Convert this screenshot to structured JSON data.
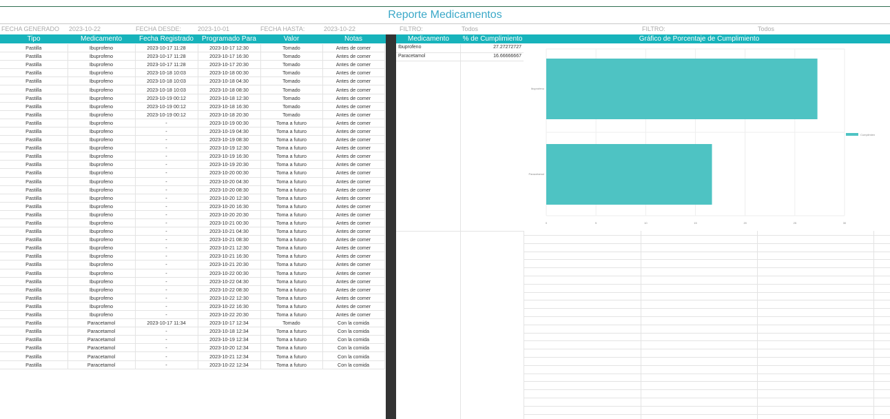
{
  "report": {
    "title": "Reporte Medicamentos",
    "meta": {
      "generado_label": "FECHA GENERADO",
      "generado_value": "2023-10-22",
      "desde_label": "FECHA DESDE:",
      "desde_value": "2023-10-01",
      "hasta_label": "FECHA HASTA:",
      "hasta_value": "2023-10-22",
      "filtro1_label": "FILTRO:",
      "filtro1_value": "Todos",
      "filtro2_label": "FILTRO:",
      "filtro2_value": "Todos"
    },
    "headers": {
      "tipo": "Tipo",
      "medicamento": "Medicamento",
      "fecha_registrado": "Fecha Registrado",
      "programado_para": "Programado Para",
      "valor": "Valor",
      "notas": "Notas",
      "sum_medicamento": "Medicamento",
      "sum_cumplimiento": "% de Cumplimiento",
      "grafico": "Gráfico de Porcentaje de Cumplimiento"
    },
    "rows": [
      [
        "Pastilla",
        "Ibuprofeno",
        "2023-10-17 11:28",
        "2023-10-17 12:30",
        "Tomado",
        "Antes de comer"
      ],
      [
        "Pastilla",
        "Ibuprofeno",
        "2023-10-17 11:28",
        "2023-10-17 16:30",
        "Tomado",
        "Antes de comer"
      ],
      [
        "Pastilla",
        "Ibuprofeno",
        "2023-10-17 11:28",
        "2023-10-17 20:30",
        "Tomado",
        "Antes de comer"
      ],
      [
        "Pastilla",
        "Ibuprofeno",
        "2023-10-18 10:03",
        "2023-10-18 00:30",
        "Tomado",
        "Antes de comer"
      ],
      [
        "Pastilla",
        "Ibuprofeno",
        "2023-10-18 10:03",
        "2023-10-18 04:30",
        "Tomado",
        "Antes de comer"
      ],
      [
        "Pastilla",
        "Ibuprofeno",
        "2023-10-18 10:03",
        "2023-10-18 08:30",
        "Tomado",
        "Antes de comer"
      ],
      [
        "Pastilla",
        "Ibuprofeno",
        "2023-10-19 00:12",
        "2023-10-18 12:30",
        "Tomado",
        "Antes de comer"
      ],
      [
        "Pastilla",
        "Ibuprofeno",
        "2023-10-19 00:12",
        "2023-10-18 16:30",
        "Tomado",
        "Antes de comer"
      ],
      [
        "Pastilla",
        "Ibuprofeno",
        "2023-10-19 00:12",
        "2023-10-18 20:30",
        "Tomado",
        "Antes de comer"
      ],
      [
        "Pastilla",
        "Ibuprofeno",
        "-",
        "2023-10-19 00:30",
        "Toma a futuro",
        "Antes de comer"
      ],
      [
        "Pastilla",
        "Ibuprofeno",
        "-",
        "2023-10-19 04:30",
        "Toma a futuro",
        "Antes de comer"
      ],
      [
        "Pastilla",
        "Ibuprofeno",
        "-",
        "2023-10-19 08:30",
        "Toma a futuro",
        "Antes de comer"
      ],
      [
        "Pastilla",
        "Ibuprofeno",
        "-",
        "2023-10-19 12:30",
        "Toma a futuro",
        "Antes de comer"
      ],
      [
        "Pastilla",
        "Ibuprofeno",
        "-",
        "2023-10-19 16:30",
        "Toma a futuro",
        "Antes de comer"
      ],
      [
        "Pastilla",
        "Ibuprofeno",
        "-",
        "2023-10-19 20:30",
        "Toma a futuro",
        "Antes de comer"
      ],
      [
        "Pastilla",
        "Ibuprofeno",
        "-",
        "2023-10-20 00:30",
        "Toma a futuro",
        "Antes de comer"
      ],
      [
        "Pastilla",
        "Ibuprofeno",
        "-",
        "2023-10-20 04:30",
        "Toma a futuro",
        "Antes de comer"
      ],
      [
        "Pastilla",
        "Ibuprofeno",
        "-",
        "2023-10-20 08:30",
        "Toma a futuro",
        "Antes de comer"
      ],
      [
        "Pastilla",
        "Ibuprofeno",
        "-",
        "2023-10-20 12:30",
        "Toma a futuro",
        "Antes de comer"
      ],
      [
        "Pastilla",
        "Ibuprofeno",
        "-",
        "2023-10-20 16:30",
        "Toma a futuro",
        "Antes de comer"
      ],
      [
        "Pastilla",
        "Ibuprofeno",
        "-",
        "2023-10-20 20:30",
        "Toma a futuro",
        "Antes de comer"
      ],
      [
        "Pastilla",
        "Ibuprofeno",
        "-",
        "2023-10-21 00:30",
        "Toma a futuro",
        "Antes de comer"
      ],
      [
        "Pastilla",
        "Ibuprofeno",
        "-",
        "2023-10-21 04:30",
        "Toma a futuro",
        "Antes de comer"
      ],
      [
        "Pastilla",
        "Ibuprofeno",
        "-",
        "2023-10-21 08:30",
        "Toma a futuro",
        "Antes de comer"
      ],
      [
        "Pastilla",
        "Ibuprofeno",
        "-",
        "2023-10-21 12:30",
        "Toma a futuro",
        "Antes de comer"
      ],
      [
        "Pastilla",
        "Ibuprofeno",
        "-",
        "2023-10-21 16:30",
        "Toma a futuro",
        "Antes de comer"
      ],
      [
        "Pastilla",
        "Ibuprofeno",
        "-",
        "2023-10-21 20:30",
        "Toma a futuro",
        "Antes de comer"
      ],
      [
        "Pastilla",
        "Ibuprofeno",
        "-",
        "2023-10-22 00:30",
        "Toma a futuro",
        "Antes de comer"
      ],
      [
        "Pastilla",
        "Ibuprofeno",
        "-",
        "2023-10-22 04:30",
        "Toma a futuro",
        "Antes de comer"
      ],
      [
        "Pastilla",
        "Ibuprofeno",
        "-",
        "2023-10-22 08:30",
        "Toma a futuro",
        "Antes de comer"
      ],
      [
        "Pastilla",
        "Ibuprofeno",
        "-",
        "2023-10-22 12:30",
        "Toma a futuro",
        "Antes de comer"
      ],
      [
        "Pastilla",
        "Ibuprofeno",
        "-",
        "2023-10-22 16:30",
        "Toma a futuro",
        "Antes de comer"
      ],
      [
        "Pastilla",
        "Ibuprofeno",
        "-",
        "2023-10-22 20:30",
        "Toma a futuro",
        "Antes de comer"
      ],
      [
        "Pastilla",
        "Paracetamol",
        "2023-10-17 11:34",
        "2023-10-17 12:34",
        "Tomado",
        "Con la comida"
      ],
      [
        "Pastilla",
        "Paracetamol",
        "-",
        "2023-10-18 12:34",
        "Toma a futuro",
        "Con la comida"
      ],
      [
        "Pastilla",
        "Paracetamol",
        "-",
        "2023-10-19 12:34",
        "Toma a futuro",
        "Con la comida"
      ],
      [
        "Pastilla",
        "Paracetamol",
        "-",
        "2023-10-20 12:34",
        "Toma a futuro",
        "Con la comida"
      ],
      [
        "Pastilla",
        "Paracetamol",
        "-",
        "2023-10-21 12:34",
        "Toma a futuro",
        "Con la comida"
      ],
      [
        "Pastilla",
        "Paracetamol",
        "-",
        "2023-10-22 12:34",
        "Toma a futuro",
        "Con la comida"
      ]
    ],
    "summary": [
      {
        "medicamento": "Ibuprofeno",
        "cumplimiento": "27.27272727"
      },
      {
        "medicamento": "Paracetamol",
        "cumplimiento": "16.66666667"
      }
    ]
  },
  "colors": {
    "header_bg": "#17b3bb",
    "bar": "#4ec3c3",
    "title": "#3aa8c8"
  },
  "chart_data": {
    "type": "bar",
    "orientation": "horizontal",
    "categories": [
      "Ibuprofeno",
      "Paracetamol"
    ],
    "series": [
      {
        "name": "Cumplimiento",
        "values": [
          27.27272727,
          16.66666667
        ]
      }
    ],
    "xlim": [
      0,
      30
    ],
    "xticks": [
      0,
      5,
      10,
      15,
      20,
      25,
      30
    ],
    "grid": true,
    "legend": "right"
  }
}
